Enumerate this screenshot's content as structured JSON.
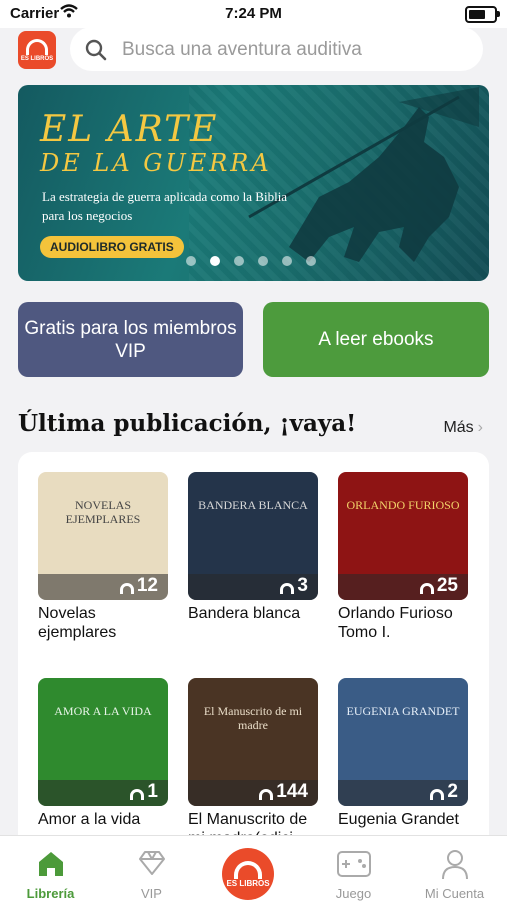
{
  "status": {
    "carrier": "Carrier",
    "time": "7:24 PM"
  },
  "header": {
    "logo_text": "ES LIBROS",
    "search_placeholder": "Busca una aventura auditiva"
  },
  "banner": {
    "title_line1": "EL ARTE",
    "title_line2": "DE LA GUERRA",
    "subtitle": "La estrategia de guerra aplicada como la Biblia para los negocios",
    "badge": "AUDIOLIBRO GRATIS",
    "slides": 6,
    "active_slide": 2
  },
  "actions": {
    "vip": "Gratis para los miembros VIP",
    "ebooks": "A leer ebooks"
  },
  "section": {
    "title": "Última publicación, ¡vaya!",
    "more": "Más"
  },
  "books": [
    {
      "title": "Novelas ejemplares",
      "cover_text": "NOVELAS EJEMPLARES",
      "count": "12",
      "cover_color": "#e8dcc0",
      "text_color": "#444444"
    },
    {
      "title": "Bandera blanca",
      "cover_text": "BANDERA BLANCA",
      "count": "3",
      "cover_color": "#24344a",
      "text_color": "#d8d8d8"
    },
    {
      "title": "Orlando Furioso Tomo I.",
      "cover_text": "ORLANDO FURIOSO",
      "count": "25",
      "cover_color": "#8e1414",
      "text_color": "#f2d36a"
    },
    {
      "title": "Amor a la vida",
      "cover_text": "AMOR A LA VIDA",
      "count": "1",
      "cover_color": "#2f8a2e",
      "text_color": "#e8f5e8"
    },
    {
      "title": "El Manuscrito de mi madre(edici",
      "cover_text": "El Manuscrito de mi madre",
      "count": "144",
      "cover_color": "#4a3424",
      "text_color": "#e9ddc8"
    },
    {
      "title": "Eugenia Grandet",
      "cover_text": "EUGENIA GRANDET",
      "count": "2",
      "cover_color": "#3a5c86",
      "text_color": "#e5eef8"
    }
  ],
  "tabs": [
    {
      "label": "Librería",
      "icon": "home-icon",
      "active": true
    },
    {
      "label": "VIP",
      "icon": "diamond-icon",
      "active": false
    },
    {
      "label": "",
      "icon": "play-center-icon",
      "active": false
    },
    {
      "label": "Juego",
      "icon": "gamepad-icon",
      "active": false
    },
    {
      "label": "Mi Cuenta",
      "icon": "person-icon",
      "active": false
    }
  ],
  "tab_center_text": "ES LIBROS",
  "colors": {
    "accent_green": "#4c9a3a",
    "brand_orange": "#ea4b2a",
    "vip_button": "#4f5880",
    "ebook_button": "#4d9b3d"
  }
}
